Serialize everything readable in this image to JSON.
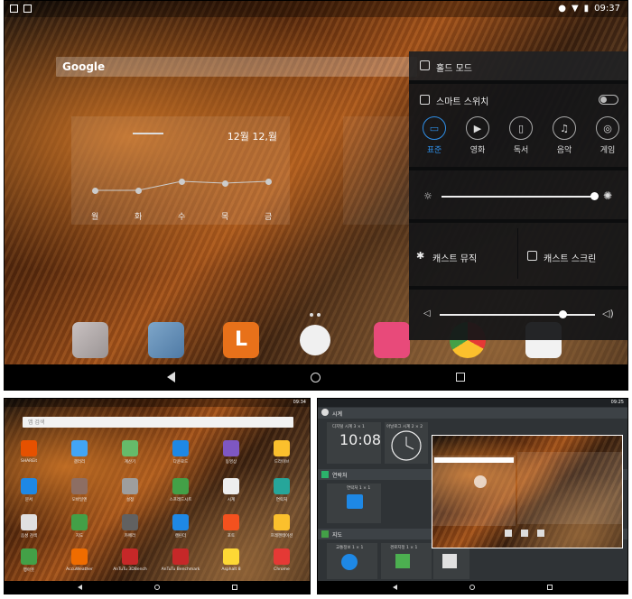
{
  "top": {
    "status_time": "09:37",
    "search_logo": "Google",
    "clock_widget": {
      "date": "12월 12,월",
      "days": [
        "월",
        "화",
        "수",
        "목",
        "금"
      ]
    },
    "quick_settings": {
      "hold_mode": "홀드 모드",
      "smart_switch": "스마트 스위치",
      "modes": [
        {
          "label": "표준",
          "icon": "monitor-icon",
          "active": true
        },
        {
          "label": "영화",
          "icon": "play-icon",
          "active": false
        },
        {
          "label": "독서",
          "icon": "book-icon",
          "active": false
        },
        {
          "label": "음악",
          "icon": "music-icon",
          "active": false
        },
        {
          "label": "게임",
          "icon": "gamepad-icon",
          "active": false
        }
      ],
      "brightness_level": 0.98,
      "cast_music": "캐스트 뮤직",
      "cast_screen": "캐스트 스크린",
      "volume_level": 0.79,
      "accent_color": "#2f8fe8"
    }
  },
  "bottom_left": {
    "status_time": "09:34",
    "search_placeholder": "앱 검색",
    "apps": [
      [
        "SHAREit",
        "갤러리",
        "계산기",
        "다운로드",
        "동영상",
        "드라이브"
      ],
      [
        "문서",
        "모바일엔",
        "설정",
        "스프레드시트",
        "시계",
        "연락처"
      ],
      [
        "음성 검색",
        "지도",
        "카메라",
        "캘린더",
        "포토",
        "프레젠테이션"
      ],
      [
        "행아웃",
        "AccuWeather",
        "AnTuTu 3DBench",
        "AnTuTu Benchmark",
        "Asphalt 8",
        "Chrome"
      ]
    ]
  },
  "bottom_right": {
    "status_time": "09:25",
    "sections": [
      "시계",
      "연락처",
      "지도"
    ],
    "clock_caption_1": "디지털 시계 3 × 1",
    "clock_caption_2": "아날로그 시계 2 × 2",
    "clock_time": "10:08",
    "contacts_caption": "연락처 1 × 1",
    "maps_caption_1": "교통정보 1 × 1",
    "maps_caption_2": "경로지정 1 × 1"
  }
}
